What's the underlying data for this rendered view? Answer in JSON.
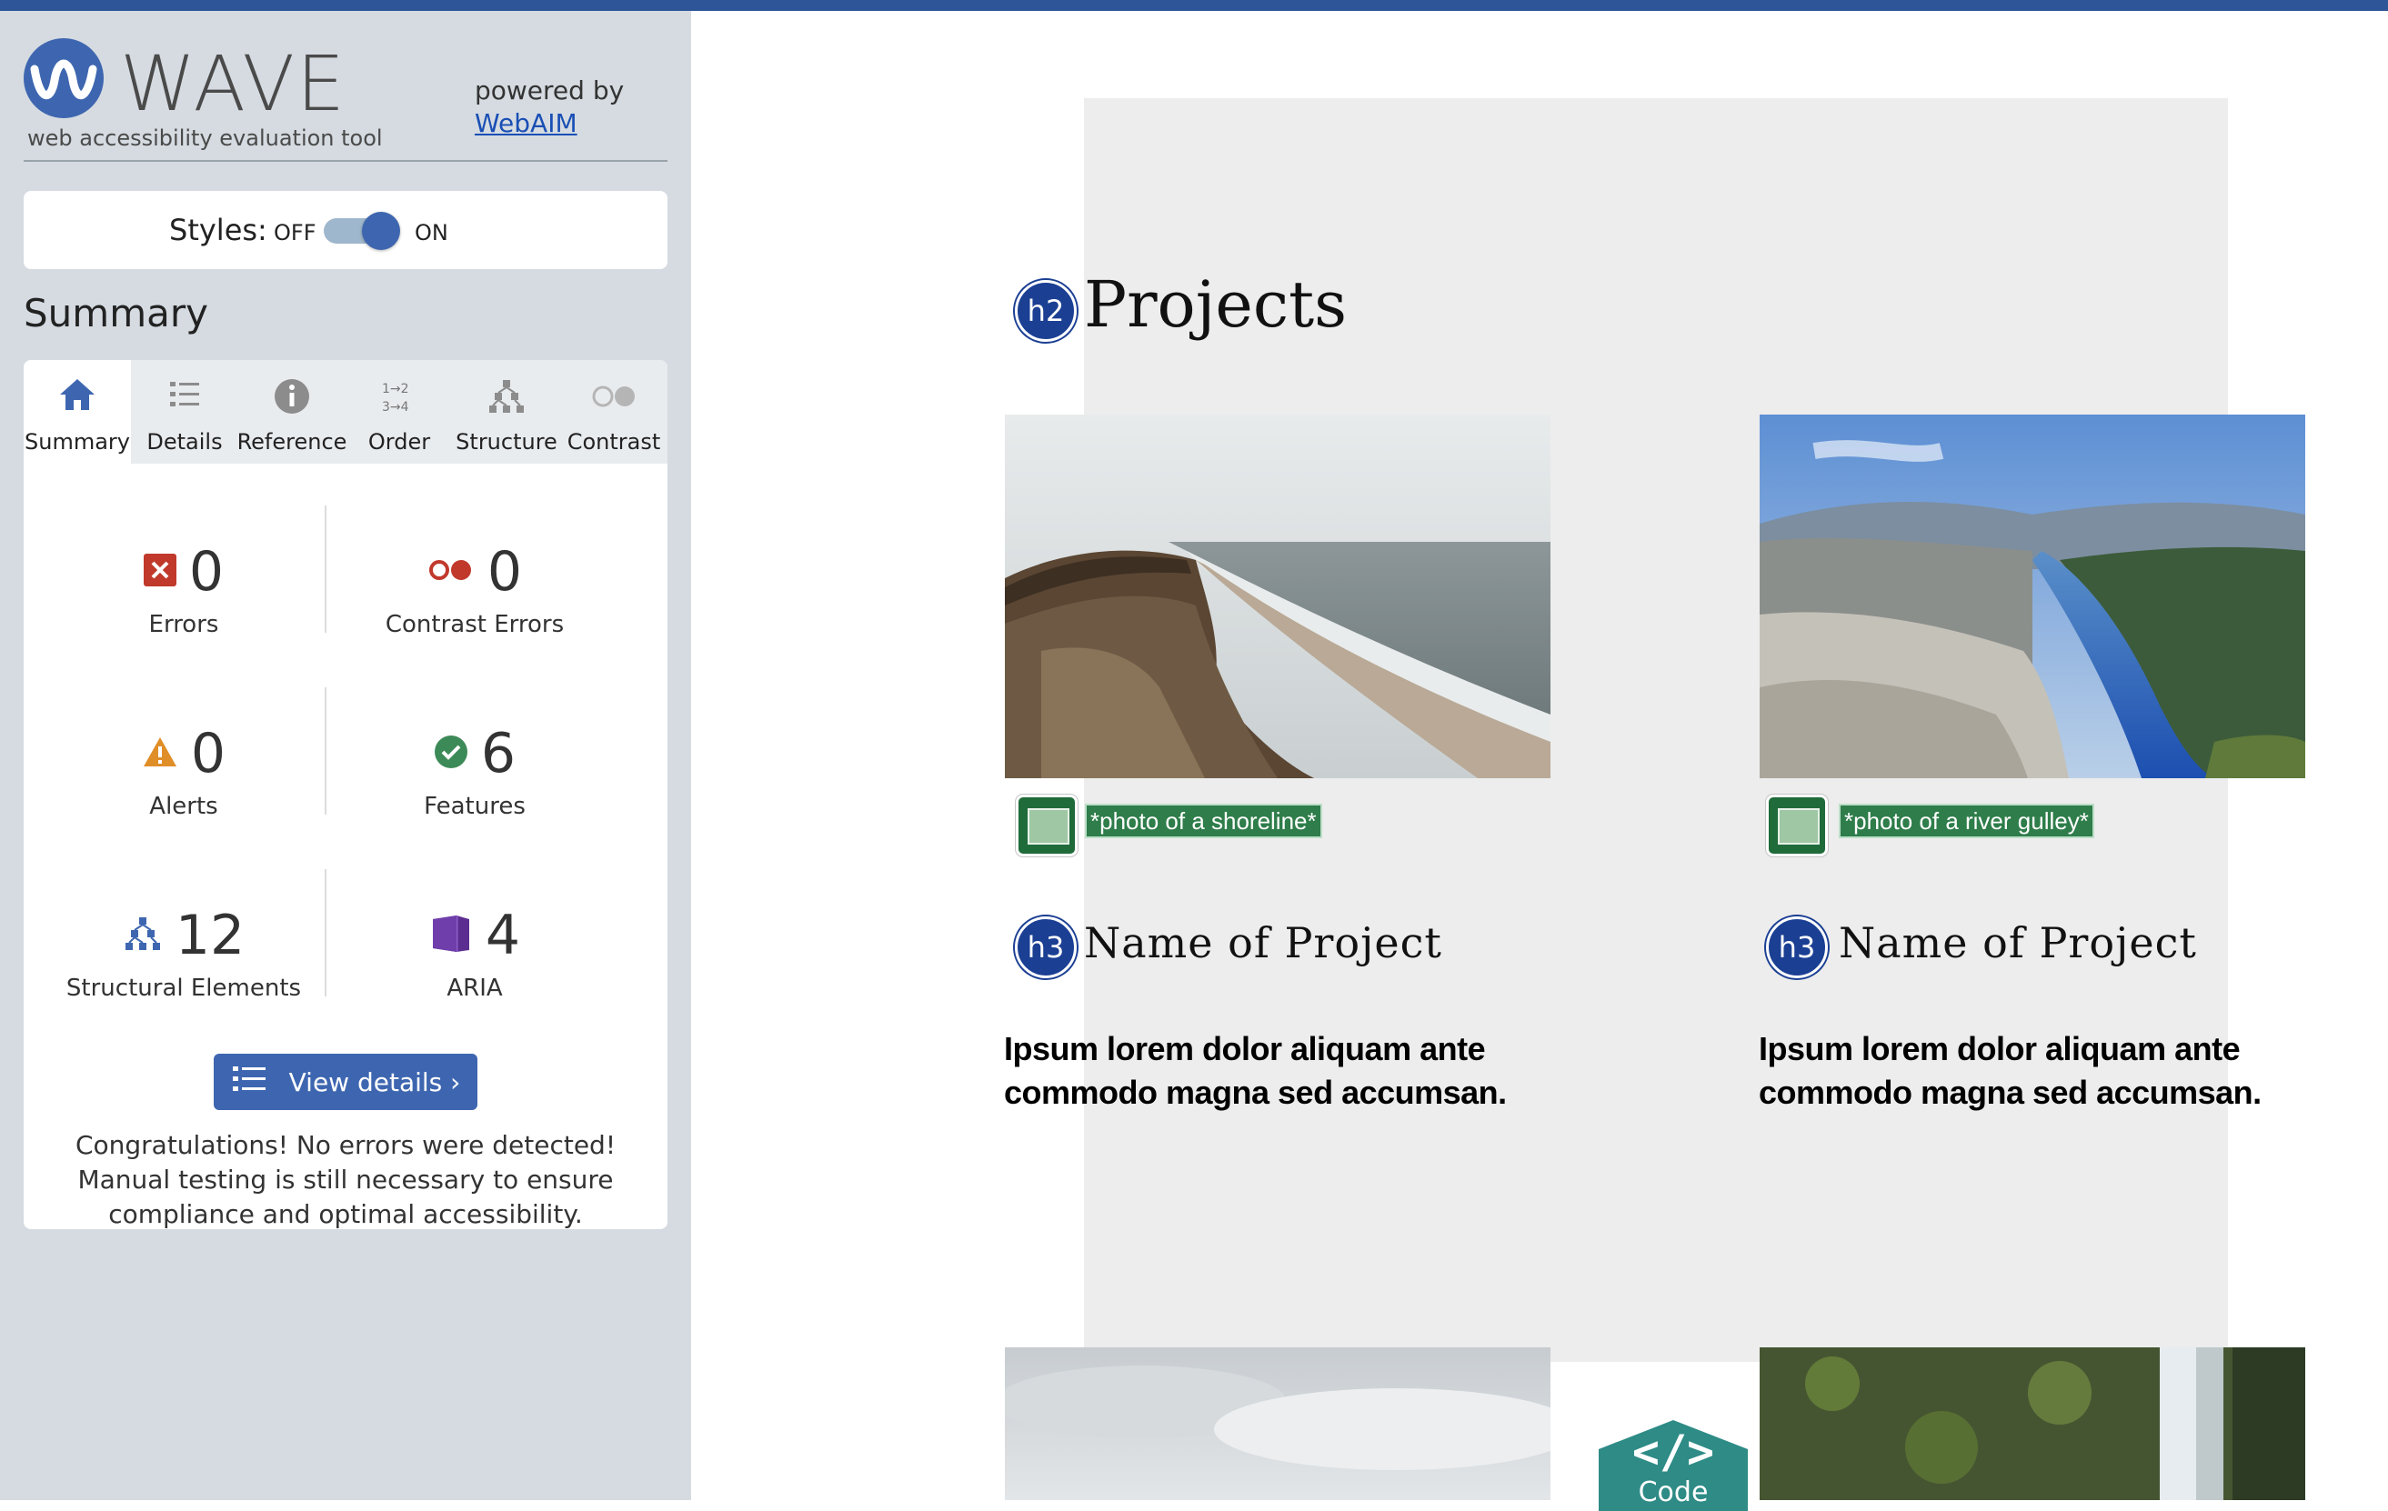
{
  "wave": {
    "brand": "WAVE",
    "subtitle": "web accessibility evaluation tool",
    "powered_by": "powered by",
    "webaim_link": "WebAIM",
    "styles_label": "Styles:",
    "styles_off": "OFF",
    "styles_on": "ON",
    "styles_enabled": true,
    "summary_title": "Summary",
    "tabs": [
      {
        "label": "Summary",
        "icon": "home-icon",
        "active": true
      },
      {
        "label": "Details",
        "icon": "list-icon",
        "active": false
      },
      {
        "label": "Reference",
        "icon": "info-icon",
        "active": false
      },
      {
        "label": "Order",
        "icon": "order-icon",
        "active": false
      },
      {
        "label": "Structure",
        "icon": "structure-icon",
        "active": false
      },
      {
        "label": "Contrast",
        "icon": "contrast-icon",
        "active": false
      }
    ],
    "stats": {
      "errors": {
        "value": "0",
        "label": "Errors",
        "icon": "error-icon",
        "color": "#c0392b"
      },
      "contrast_errors": {
        "value": "0",
        "label": "Contrast Errors",
        "icon": "contrast-error-icon",
        "color": "#c0392b"
      },
      "alerts": {
        "value": "0",
        "label": "Alerts",
        "icon": "alert-icon",
        "color": "#e08e28"
      },
      "features": {
        "value": "6",
        "label": "Features",
        "icon": "feature-check-icon",
        "color": "#3c8a57"
      },
      "structural": {
        "value": "12",
        "label": "Structural Elements",
        "icon": "structure-icon",
        "color": "#3e66b0"
      },
      "aria": {
        "value": "4",
        "label": "ARIA",
        "icon": "aria-icon",
        "color": "#5c2d91"
      }
    },
    "view_details": "View details ›",
    "congrats": "Congratulations! No errors were detected! Manual testing is still necessary to ensure compliance and optimal accessibility."
  },
  "page": {
    "h2_badge": "h2",
    "heading": "Projects",
    "projects": [
      {
        "alt": "*photo of a shoreline*",
        "h3_badge": "h3",
        "name": "Name of Project",
        "desc": "Ipsum lorem dolor aliquam ante commodo magna sed accumsan."
      },
      {
        "alt": "*photo of a river gulley*",
        "h3_badge": "h3",
        "name": "Name of Project",
        "desc": "Ipsum lorem dolor aliquam ante commodo magna sed accumsan."
      }
    ],
    "code_label": "Code",
    "code_glyph": "</>"
  },
  "colors": {
    "accent": "#3e66b0",
    "topbar": "#2d5597",
    "sidebar_bg": "#d5dbe1",
    "heading_badge": "#1b3f93",
    "image_badge": "#1f6b3a",
    "code_tab": "#2e8b86"
  }
}
